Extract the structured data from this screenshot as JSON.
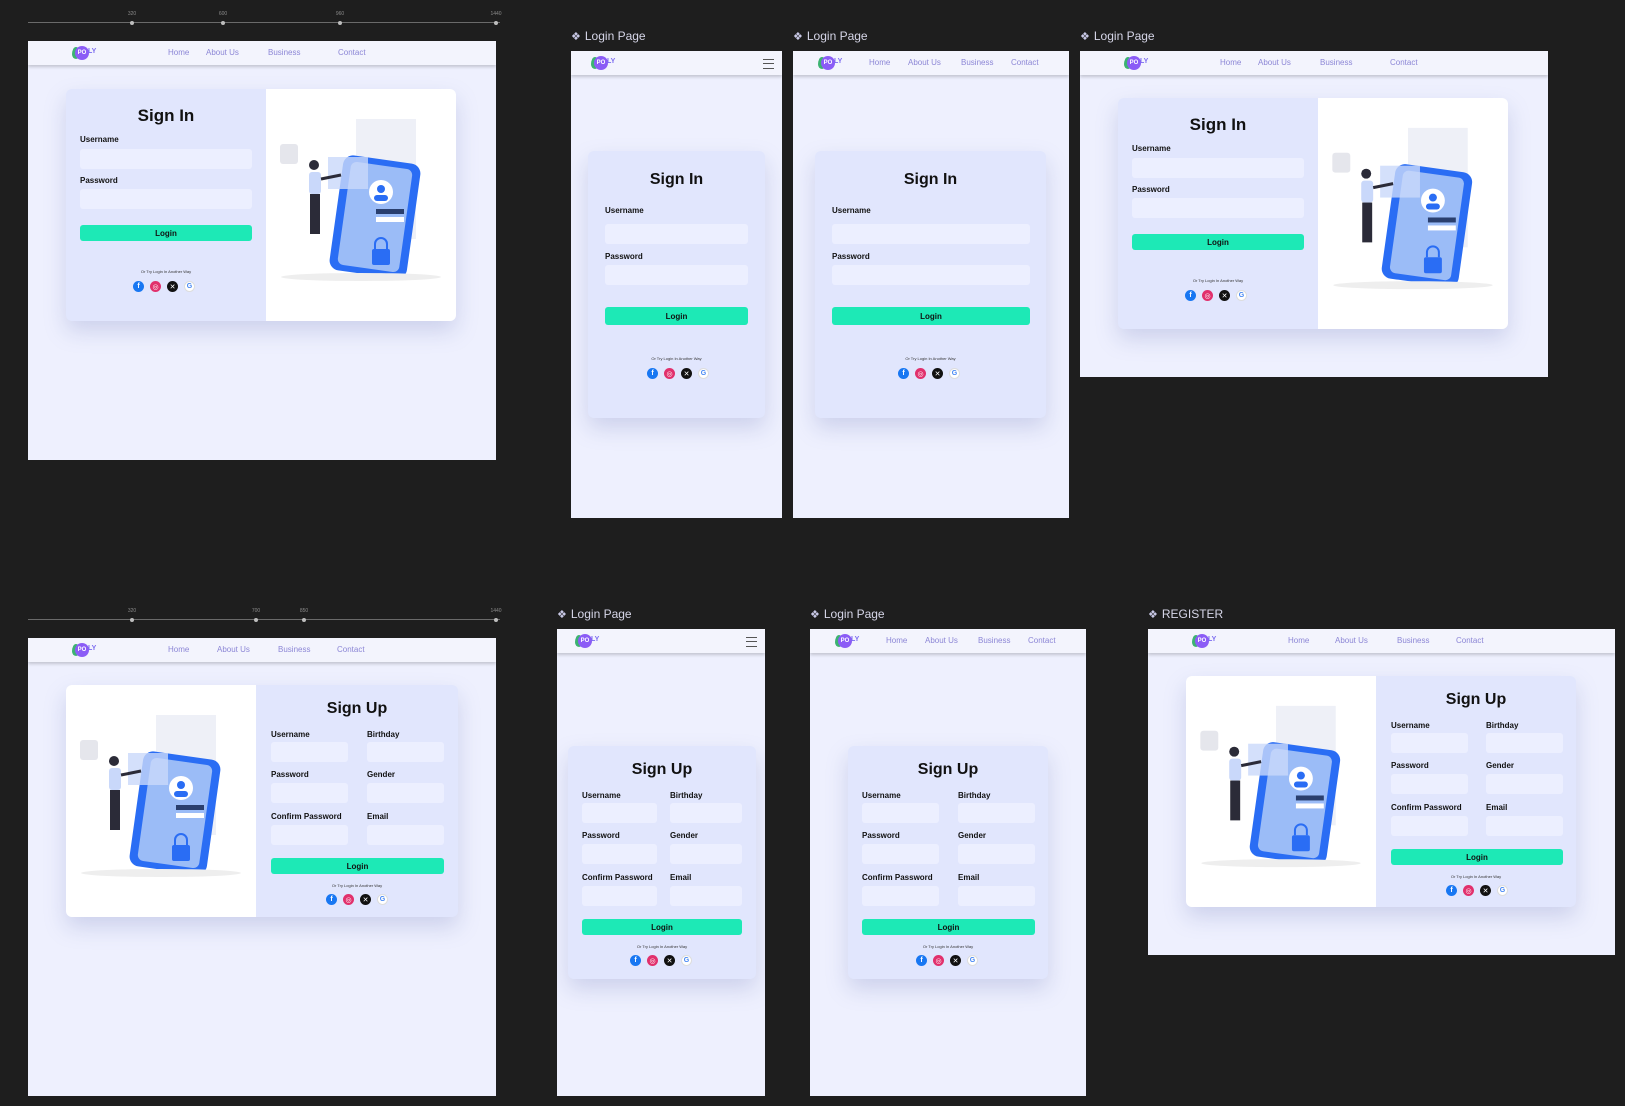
{
  "frames": {
    "f2_title": "Login Page",
    "f3_title": "Login Page",
    "f4_title": "Login Page",
    "f6_title": "Login Page",
    "f7_title": "Login Page",
    "f8_title": "REGISTER"
  },
  "nav": {
    "logo_text": "LY",
    "logo_mark": "PO",
    "home": "Home",
    "about": "About Us",
    "business": "Business",
    "contact": "Contact"
  },
  "signin": {
    "title": "Sign In",
    "username_label": "Username",
    "password_label": "Password",
    "login_button": "Login",
    "alt_text": "Or Try Login In Another Way"
  },
  "signup": {
    "title": "Sign Up",
    "username_label": "Username",
    "birthday_label": "Birthday",
    "password_label": "Password",
    "gender_label": "Gender",
    "confirm_label": "Confirm Password",
    "email_label": "Email",
    "login_button": "Login",
    "alt_text": "Or Try Login In Another Way"
  },
  "icons": [
    "facebook-icon",
    "instagram-icon",
    "x-icon",
    "google-icon",
    "menu-icon",
    "component-icon"
  ],
  "colors": {
    "page_bg": "#1e1e1e",
    "frame_bg": "#eef0fe",
    "card_bg": "#e1e6fd",
    "accent": "#1de9b6",
    "nav_link": "#8c86d6"
  },
  "rulers": {
    "top": [
      "320",
      "600",
      "960",
      "1440"
    ],
    "bottom": [
      "320",
      "700",
      "850",
      "1440"
    ]
  }
}
